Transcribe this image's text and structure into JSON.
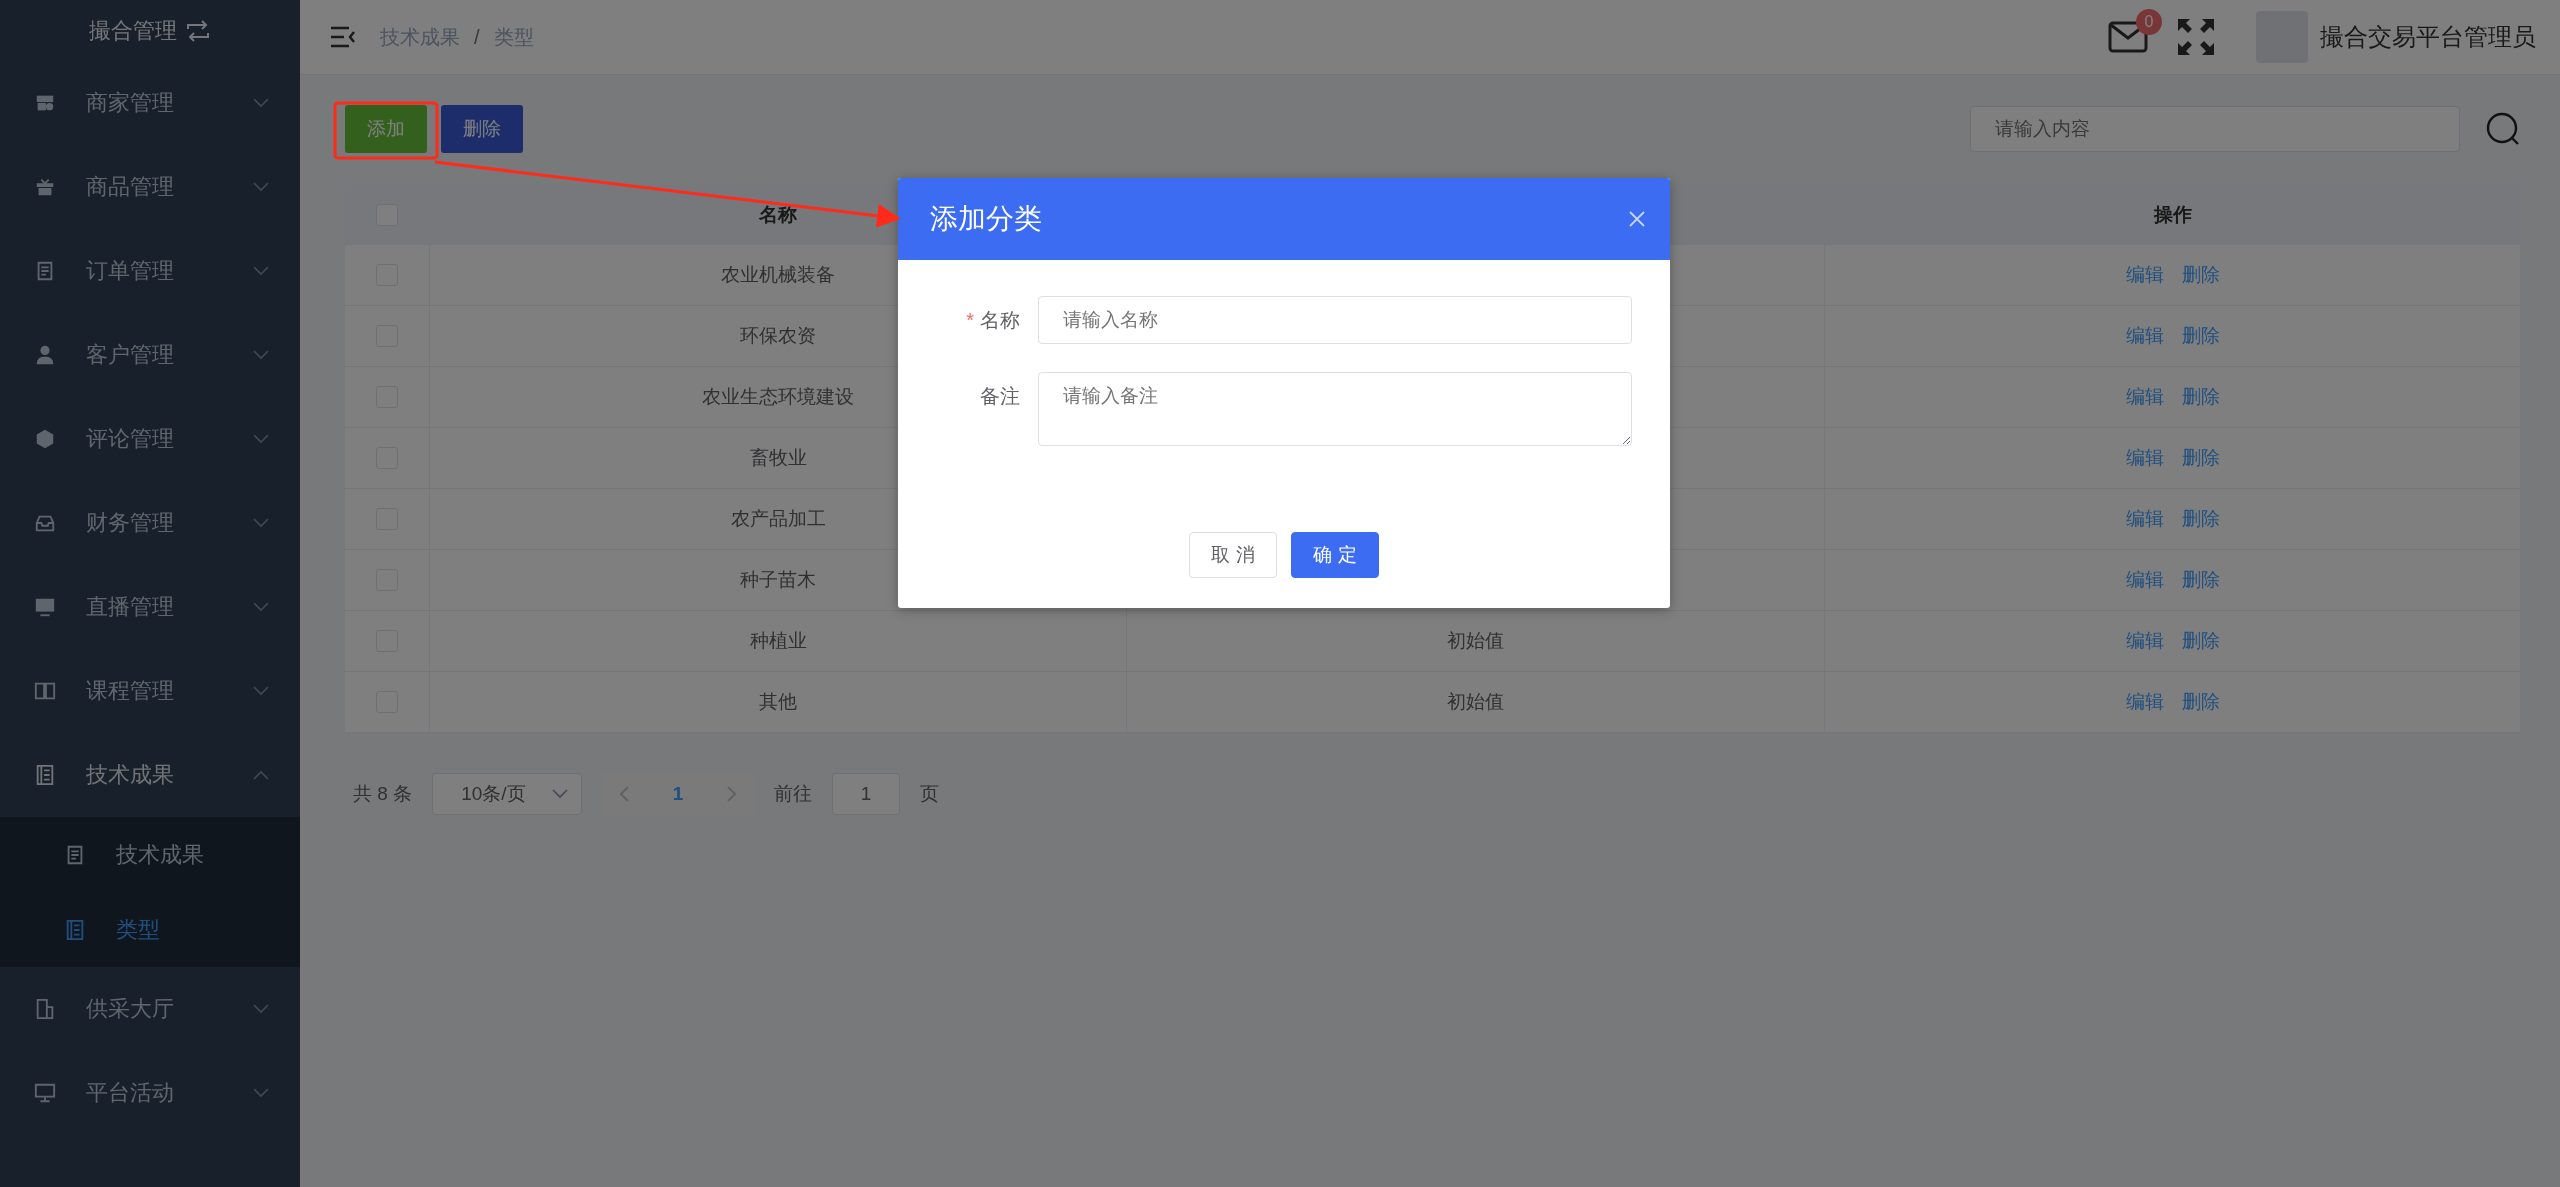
{
  "sidebar": {
    "title": "撮合管理",
    "items": [
      {
        "label": "商家管理",
        "expanded": false
      },
      {
        "label": "商品管理",
        "expanded": false
      },
      {
        "label": "订单管理",
        "expanded": false
      },
      {
        "label": "客户管理",
        "expanded": false
      },
      {
        "label": "评论管理",
        "expanded": false
      },
      {
        "label": "财务管理",
        "expanded": false
      },
      {
        "label": "直播管理",
        "expanded": false
      },
      {
        "label": "课程管理",
        "expanded": false
      },
      {
        "label": "技术成果",
        "expanded": true,
        "children": [
          {
            "label": "技术成果",
            "selected": false
          },
          {
            "label": "类型",
            "selected": true
          }
        ]
      },
      {
        "label": "供采大厅",
        "expanded": false
      },
      {
        "label": "平台活动",
        "expanded": false
      }
    ]
  },
  "topbar": {
    "breadcrumb": [
      "技术成果",
      "类型"
    ],
    "breadcrumb_separator": "/",
    "message_count": "0",
    "user_name": "撮合交易平台管理员"
  },
  "toolbar": {
    "buttons": [
      {
        "label": "添加",
        "kind": "add"
      },
      {
        "label": "删除",
        "kind": "delete"
      }
    ],
    "search": {
      "placeholder": "请输入内容"
    }
  },
  "table": {
    "header_checked": false,
    "columns": {
      "name": "名称",
      "actions": "操作"
    },
    "rows": [
      {
        "name": "农业机械装备",
        "checked": false,
        "actions": [
          "编辑",
          "删除"
        ]
      },
      {
        "name": "环保农资",
        "checked": false,
        "actions": [
          "编辑",
          "删除"
        ]
      },
      {
        "name": "农业生态环境建设",
        "checked": false,
        "actions": [
          "编辑",
          "删除"
        ]
      },
      {
        "name": "畜牧业",
        "checked": false,
        "actions": [
          "编辑",
          "删除"
        ]
      },
      {
        "name": "农产品加工",
        "checked": false,
        "actions": [
          "编辑",
          "删除"
        ]
      },
      {
        "name": "种子苗木",
        "checked": false,
        "actions": [
          "编辑",
          "删除"
        ]
      },
      {
        "name": "种植业",
        "column_2": "初始值",
        "checked": false,
        "actions": [
          "编辑",
          "删除"
        ]
      },
      {
        "name": "其他",
        "column_2": "初始值",
        "checked": false,
        "actions": [
          "编辑",
          "删除"
        ]
      }
    ]
  },
  "pagination": {
    "total": "共 8 条",
    "page_size": "10条/页",
    "pages": [
      {
        "label": "1",
        "selected": true
      }
    ],
    "goto_label": "前往",
    "goto_value": "1",
    "goto_suffix": "页"
  },
  "dialog": {
    "title": "添加分类",
    "required_mark": "*",
    "fields": [
      {
        "kind": "input",
        "label": "名称",
        "required": true,
        "placeholder": "请输入名称"
      },
      {
        "kind": "textarea",
        "label": "备注",
        "required": false,
        "placeholder": "请输入备注"
      }
    ],
    "buttons": [
      {
        "kind": "cancel",
        "label": "取 消"
      },
      {
        "kind": "primary",
        "label": "确 定"
      }
    ]
  }
}
